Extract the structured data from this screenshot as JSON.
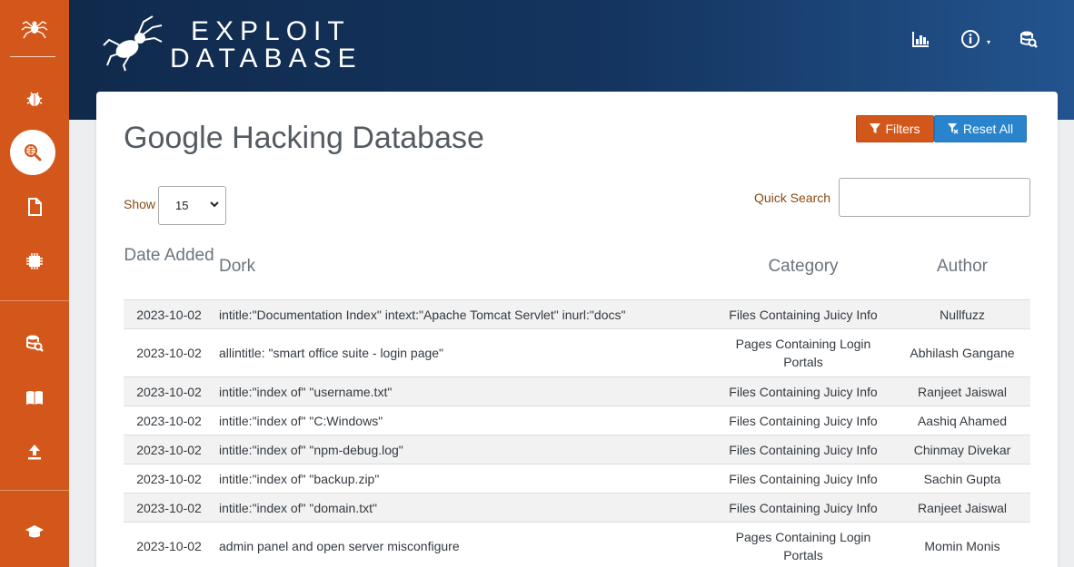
{
  "sidebar": {
    "items": [
      {
        "name": "exploits",
        "icon": "bug-icon"
      },
      {
        "name": "ghdb",
        "icon": "search-globe-icon",
        "active": true
      },
      {
        "name": "papers",
        "icon": "document-icon"
      },
      {
        "name": "shellcodes",
        "icon": "chip-icon"
      },
      {
        "name": "search-edb",
        "icon": "database-search-icon"
      },
      {
        "name": "submissions",
        "icon": "book-open-icon"
      },
      {
        "name": "upload",
        "icon": "upload-icon"
      },
      {
        "name": "training",
        "icon": "graduation-cap-icon"
      }
    ],
    "accent": "#d3571a"
  },
  "header": {
    "brand_line1": "EXPLOIT",
    "brand_line2": "DATABASE",
    "icons": [
      "stats-icon",
      "info-icon",
      "database-search-icon"
    ]
  },
  "page": {
    "title": "Google Hacking Database",
    "filters_label": "Filters",
    "reset_label": "Reset All",
    "show_label": "Show",
    "show_value": "15",
    "quick_search_label": "Quick Search",
    "quick_search_value": ""
  },
  "table": {
    "headers": {
      "date": "Date Added",
      "dork": "Dork",
      "category": "Category",
      "author": "Author"
    },
    "rows": [
      {
        "date": "2023-10-02",
        "dork": "intitle:\"Documentation Index\" intext:\"Apache Tomcat Servlet\" inurl:\"docs\"",
        "category": "Files Containing Juicy Info",
        "author": "Nullfuzz"
      },
      {
        "date": "2023-10-02",
        "dork": "allintitle: \"smart office suite - login page\"",
        "category": "Pages Containing Login Portals",
        "author": "Abhilash Gangane"
      },
      {
        "date": "2023-10-02",
        "dork": "intitle:\"index of\" \"username.txt\"",
        "category": "Files Containing Juicy Info",
        "author": "Ranjeet Jaiswal"
      },
      {
        "date": "2023-10-02",
        "dork": "intitle:\"index of\" \"C:Windows\"",
        "category": "Files Containing Juicy Info",
        "author": "Aashiq Ahamed"
      },
      {
        "date": "2023-10-02",
        "dork": "intitle:\"index of\" \"npm-debug.log\"",
        "category": "Files Containing Juicy Info",
        "author": "Chinmay Divekar"
      },
      {
        "date": "2023-10-02",
        "dork": "intitle:\"index of\" \"backup.zip\"",
        "category": "Files Containing Juicy Info",
        "author": "Sachin Gupta"
      },
      {
        "date": "2023-10-02",
        "dork": "intitle:\"index of\" \"domain.txt\"",
        "category": "Files Containing Juicy Info",
        "author": "Ranjeet Jaiswal"
      },
      {
        "date": "2023-10-02",
        "dork": "admin panel and open server misconfigure",
        "category": "Pages Containing Login Portals",
        "author": "Momin Monis"
      }
    ]
  }
}
